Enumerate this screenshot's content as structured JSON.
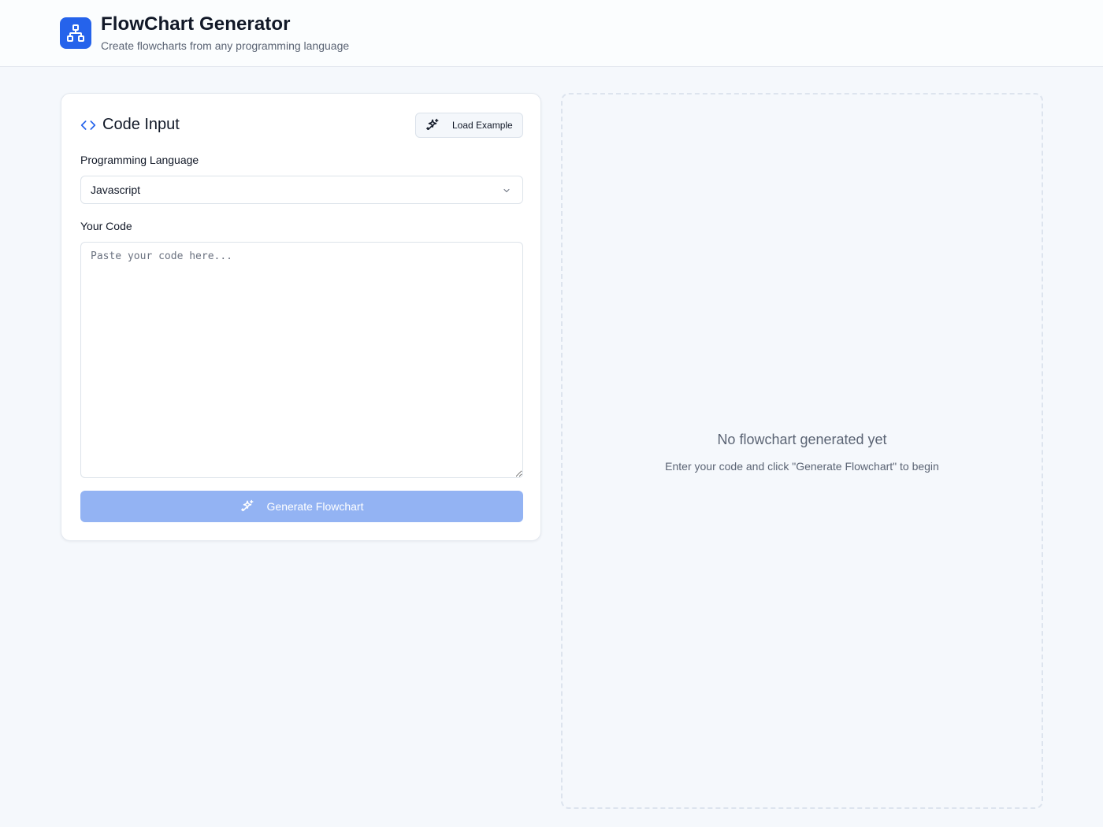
{
  "header": {
    "logo_icon": "flowchart-network-icon",
    "title": "FlowChart Generator",
    "subtitle": "Create flowcharts from any programming language"
  },
  "code_input": {
    "icon": "code-brackets-icon",
    "title": "Code Input",
    "load_example_icon": "sparkles-icon",
    "load_example_label": "Load Example",
    "language_label": "Programming Language",
    "language_value": "Javascript",
    "code_label": "Your Code",
    "code_placeholder": "Paste your code here...",
    "code_value": "",
    "generate_icon": "sparkles-icon",
    "generate_label": "Generate Flowchart",
    "generate_disabled": true
  },
  "output": {
    "empty_title": "No flowchart generated yet",
    "empty_subtitle": "Enter your code and click \"Generate Flowchart\" to begin"
  },
  "colors": {
    "accent": "#2563eb",
    "accent_disabled": "#93b3f3",
    "background": "#f5f8fc",
    "muted_text": "#5b6474"
  }
}
